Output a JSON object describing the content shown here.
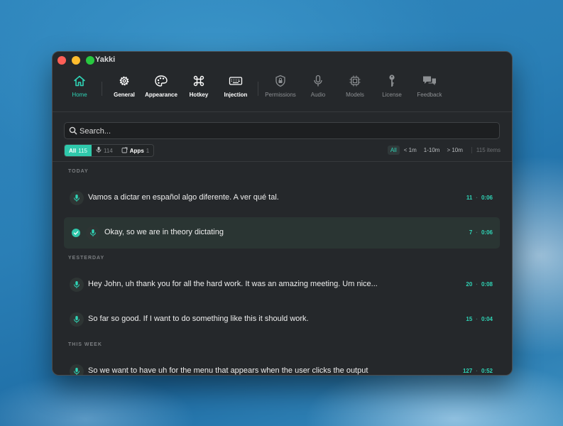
{
  "window": {
    "title": "Yakki"
  },
  "toolbar": {
    "items": [
      {
        "label": "Home",
        "icon": "home-icon"
      },
      {
        "label": "General",
        "icon": "gear-icon"
      },
      {
        "label": "Appearance",
        "icon": "palette-icon"
      },
      {
        "label": "Hotkey",
        "icon": "command-key-icon"
      },
      {
        "label": "Injection",
        "icon": "keyboard-icon"
      },
      {
        "label": "Permissions",
        "icon": "shield-lock-icon"
      },
      {
        "label": "Audio",
        "icon": "microphone-icon"
      },
      {
        "label": "Models",
        "icon": "chip-icon"
      },
      {
        "label": "License",
        "icon": "key-icon"
      },
      {
        "label": "Feedback",
        "icon": "chat-bubbles-icon"
      }
    ]
  },
  "search": {
    "placeholder": "Search..."
  },
  "filters": {
    "all": {
      "label": "All",
      "count": "115"
    },
    "voice": {
      "count": "114"
    },
    "apps": {
      "label": "Apps",
      "count": "1"
    }
  },
  "duration": {
    "options": [
      "All",
      "< 1m",
      "1-10m",
      "> 10m"
    ],
    "items_count": "115 items"
  },
  "colors": {
    "accent": "#2fd3b5",
    "background": "#25282b",
    "selected_row": "#2a3533"
  },
  "sections": [
    {
      "label": "TODAY",
      "rows": [
        {
          "text": "Vamos a dictar en español algo diferente. A ver qué tal.",
          "words": "11",
          "duration": "0:06",
          "selected": false
        },
        {
          "text": "Okay, so we are in theory dictating",
          "words": "7",
          "duration": "0:06",
          "selected": true
        }
      ]
    },
    {
      "label": "YESTERDAY",
      "rows": [
        {
          "text": "Hey John, uh thank you for all the hard work. It was an amazing meeting. Um nice...",
          "words": "20",
          "duration": "0:08",
          "selected": false
        },
        {
          "text": "So far so good. If I want to do something like this it should work.",
          "words": "15",
          "duration": "0:04",
          "selected": false
        }
      ]
    },
    {
      "label": "THIS WEEK",
      "rows": [
        {
          "text": "So we want to have uh for the menu that appears when the user clicks the output",
          "words": "127",
          "duration": "0:52",
          "selected": false
        }
      ]
    }
  ]
}
